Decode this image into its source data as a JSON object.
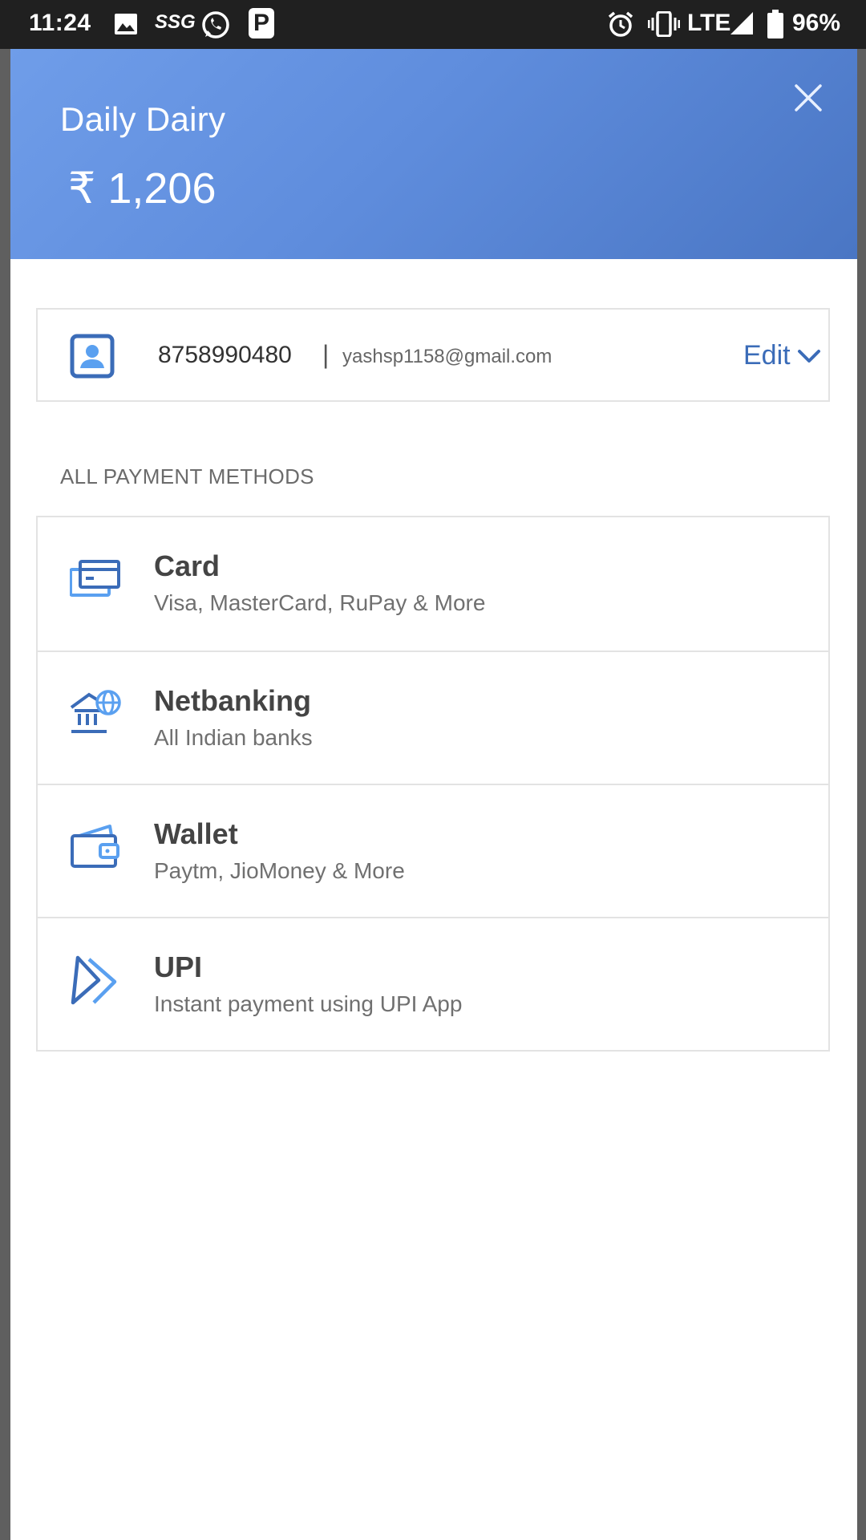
{
  "status_bar": {
    "time": "11:24",
    "network": "LTE",
    "battery": "96%",
    "icons": [
      "image-icon",
      "ssg-icon",
      "whatsapp-icon",
      "p-icon",
      "alarm-icon",
      "vibrate-icon",
      "signal-icon",
      "battery-icon"
    ],
    "ssg_text": "SSG",
    "p_text": "P"
  },
  "header": {
    "merchant": "Daily Dairy",
    "amount": "₹ 1,206"
  },
  "contact": {
    "phone": "8758990480",
    "separator": "|",
    "email": "yashsp1158@gmail.com",
    "edit_label": "Edit"
  },
  "section_title": "ALL PAYMENT METHODS",
  "methods": [
    {
      "title": "Card",
      "subtitle": "Visa, MasterCard, RuPay & More",
      "icon": "card-icon"
    },
    {
      "title": "Netbanking",
      "subtitle": "All Indian banks",
      "icon": "bank-icon"
    },
    {
      "title": "Wallet",
      "subtitle": "Paytm, JioMoney & More",
      "icon": "wallet-icon"
    },
    {
      "title": "UPI",
      "subtitle": "Instant payment using UPI App",
      "icon": "upi-icon"
    }
  ],
  "colors": {
    "header_start": "#6f9de9",
    "header_end": "#4a76c4",
    "accent": "#3b6cb8",
    "icon_light": "#5aa0f0"
  }
}
